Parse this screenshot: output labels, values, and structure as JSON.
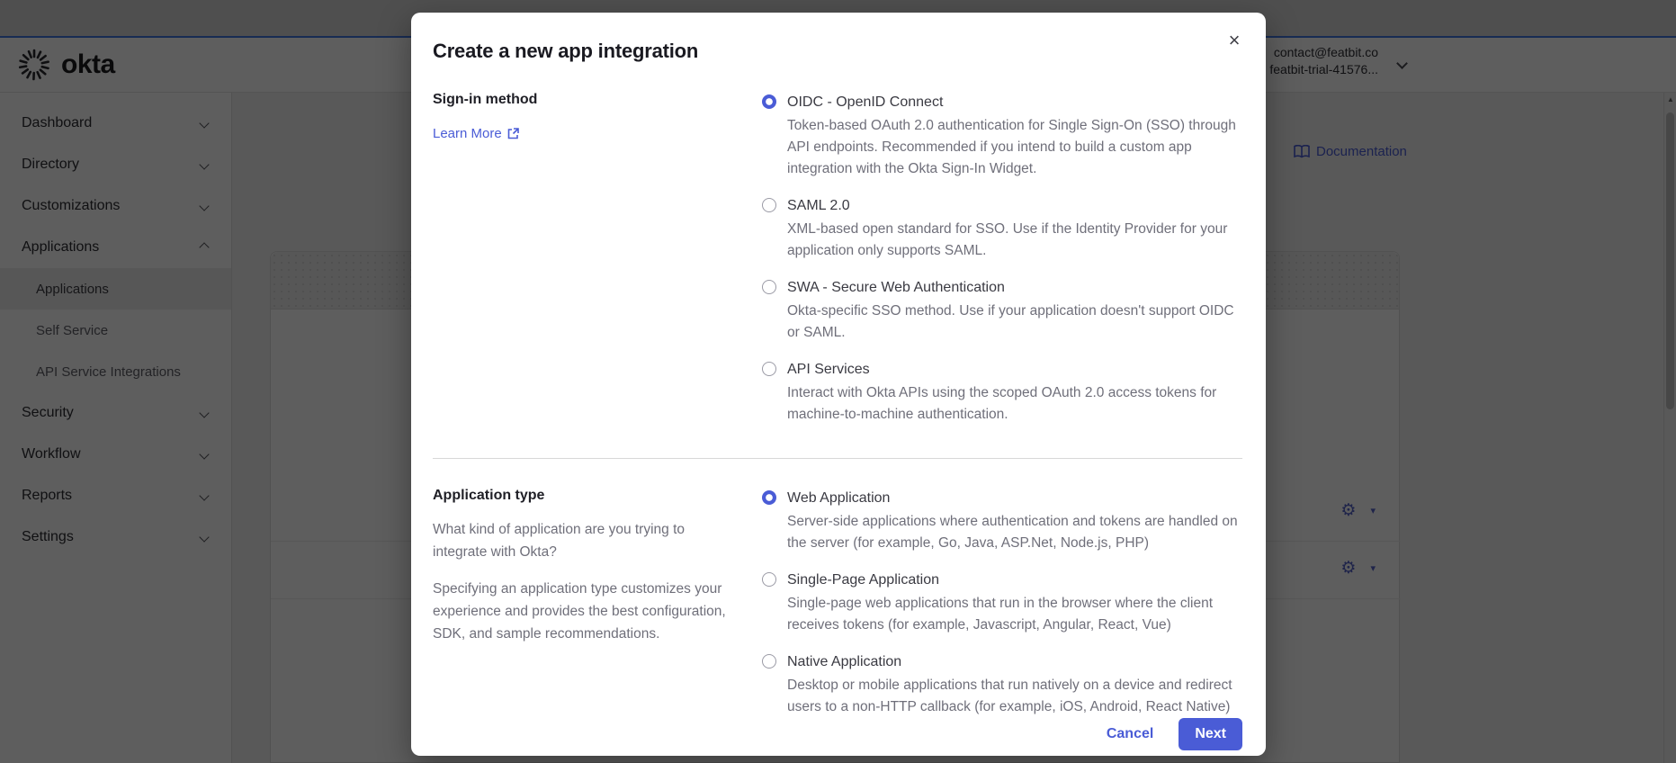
{
  "colors": {
    "accent": "#4a5cd6",
    "overlay": "rgba(0,0,0,0.63)"
  },
  "header": {
    "brand": "okta",
    "account": {
      "email": "contact@featbit.co",
      "org": "featbit-trial-41576..."
    }
  },
  "background": {
    "documentation_label": "Documentation"
  },
  "sidebar": {
    "items": [
      {
        "label": "Dashboard"
      },
      {
        "label": "Directory"
      },
      {
        "label": "Customizations"
      },
      {
        "label": "Applications",
        "expanded": true
      },
      {
        "label": "Applications",
        "sub": true,
        "selected": true
      },
      {
        "label": "Self Service",
        "sub": true
      },
      {
        "label": "API Service Integrations",
        "sub": true
      },
      {
        "label": "Security"
      },
      {
        "label": "Workflow"
      },
      {
        "label": "Reports"
      },
      {
        "label": "Settings"
      }
    ]
  },
  "modal": {
    "title": "Create a new app integration",
    "close_icon": "×",
    "signin": {
      "label": "Sign-in method",
      "learn_more": "Learn More",
      "options": [
        {
          "name": "OIDC - OpenID Connect",
          "desc": "Token-based OAuth 2.0 authentication for Single Sign-On (SSO) through API endpoints. Recommended if you intend to build a custom app integration with the Okta Sign-In Widget.",
          "selected": true
        },
        {
          "name": "SAML 2.0",
          "desc": "XML-based open standard for SSO. Use if the Identity Provider for your application only supports SAML.",
          "selected": false
        },
        {
          "name": "SWA - Secure Web Authentication",
          "desc": "Okta-specific SSO method. Use if your application doesn't support OIDC or SAML.",
          "selected": false
        },
        {
          "name": "API Services",
          "desc": "Interact with Okta APIs using the scoped OAuth 2.0 access tokens for machine-to-machine authentication.",
          "selected": false
        }
      ]
    },
    "apptype": {
      "label": "Application type",
      "help1": "What kind of application are you trying to integrate with Okta?",
      "help2": "Specifying an application type customizes your experience and provides the best configuration, SDK, and sample recommendations.",
      "options": [
        {
          "name": "Web Application",
          "desc": "Server-side applications where authentication and tokens are handled on the server (for example, Go, Java, ASP.Net, Node.js, PHP)",
          "selected": true
        },
        {
          "name": "Single-Page Application",
          "desc": "Single-page web applications that run in the browser where the client receives tokens (for example, Javascript, Angular, React, Vue)",
          "selected": false
        },
        {
          "name": "Native Application",
          "desc": "Desktop or mobile applications that run natively on a device and redirect users to a non-HTTP callback (for example, iOS, Android, React Native)",
          "selected": false
        }
      ]
    },
    "footer": {
      "cancel": "Cancel",
      "next": "Next"
    }
  },
  "icons": {
    "gear": "⚙",
    "caret_down": "▾",
    "scroll_up": "▲"
  }
}
